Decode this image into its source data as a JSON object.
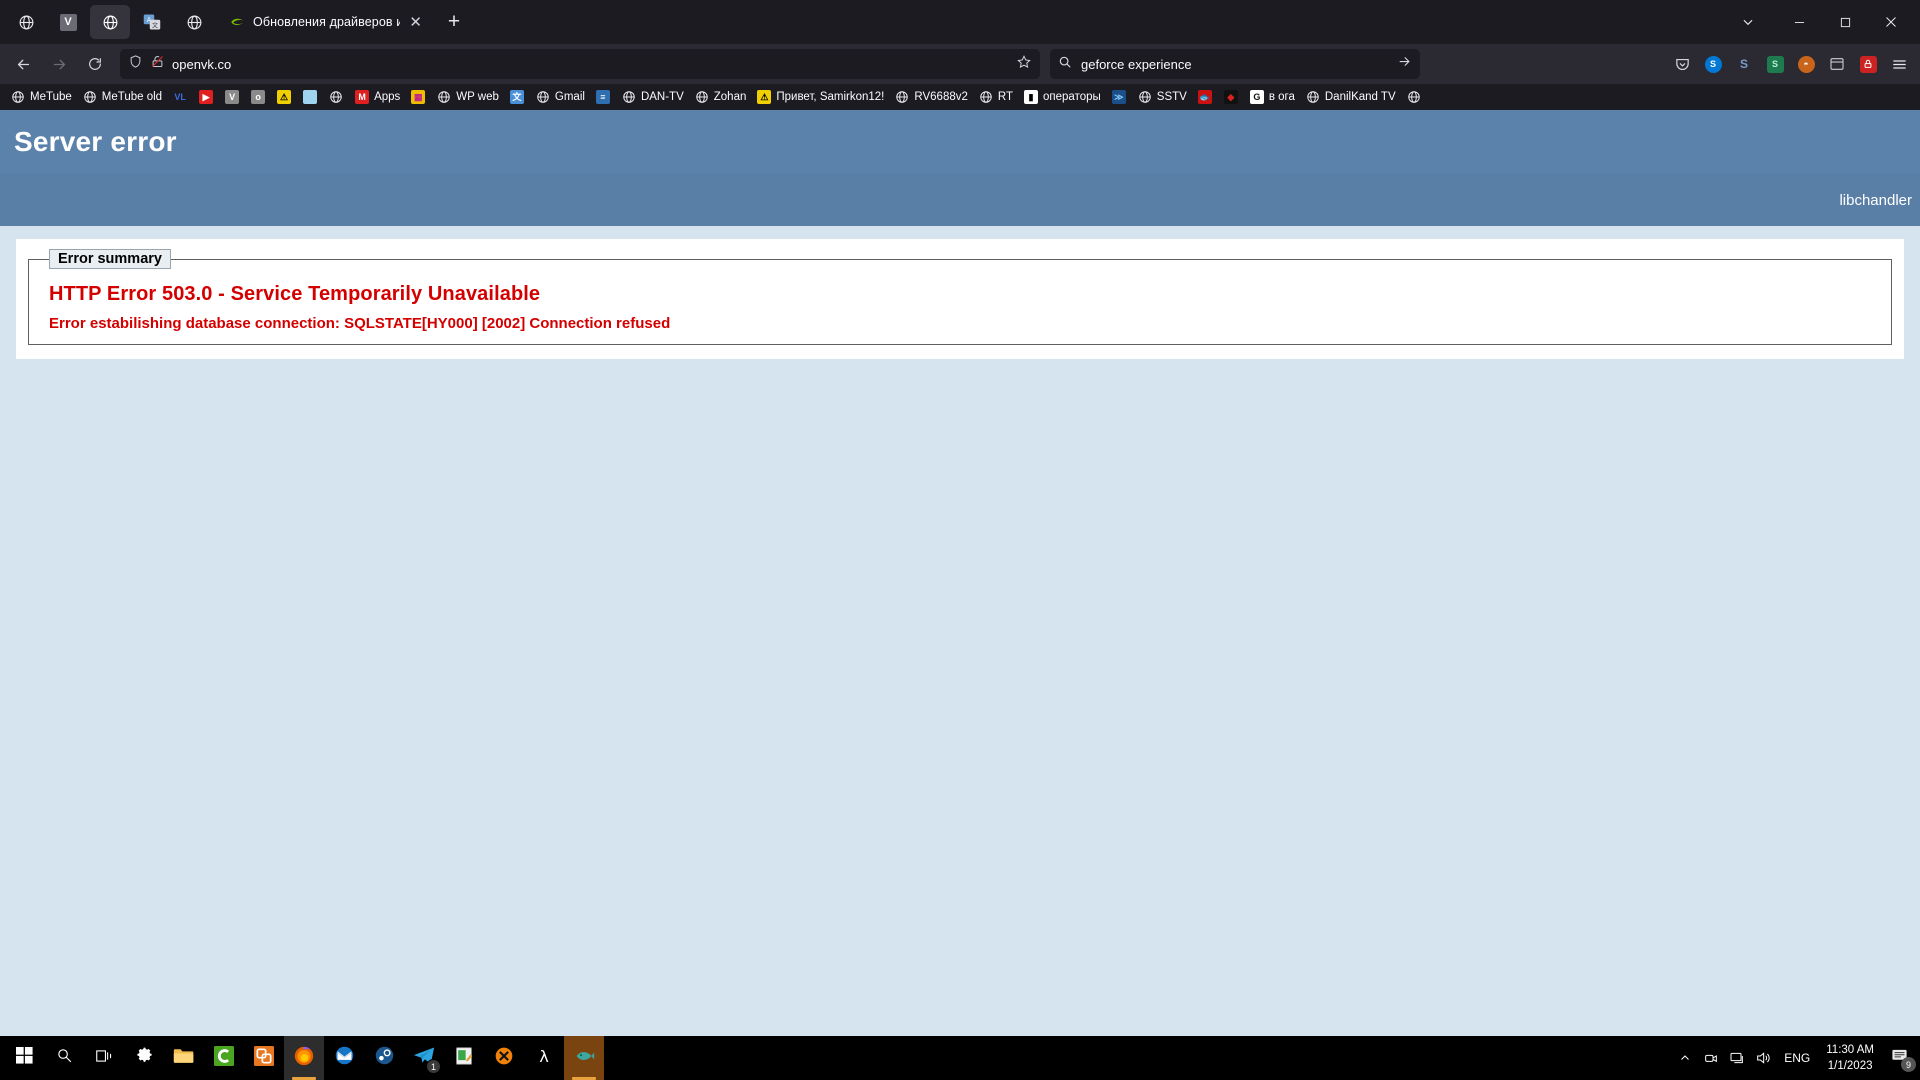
{
  "browser": {
    "pinned_tabs": [
      {
        "name": "globe-icon",
        "type": "globe"
      },
      {
        "name": "vk-icon",
        "type": "letter",
        "letter": "V",
        "bg": "#6b6b76"
      },
      {
        "name": "globe-icon-active",
        "type": "globe",
        "active": true
      },
      {
        "name": "translate-icon",
        "type": "translate"
      },
      {
        "name": "globe-icon-2",
        "type": "globe"
      }
    ],
    "tab": {
      "title": "Обновления драйверов и опти",
      "favicon": "nvidia-icon",
      "close_label": "✕"
    },
    "new_tab_label": "+",
    "window_controls": {
      "list_all_tabs": "⌄",
      "minimize": "—",
      "maximize": "▢",
      "close": "✕"
    },
    "nav": {
      "back": "←",
      "forward": "→",
      "reload": "⟳"
    },
    "urlbar": {
      "shield_icon": "shield-icon",
      "lock_icon": "broken-lock-icon",
      "url": "openvk.co",
      "bookmark_star": "☆"
    },
    "search": {
      "icon": "search-icon",
      "value": "geforce experience",
      "go": "→"
    },
    "extensions": [
      {
        "name": "pocket-icon",
        "glyph": "⌵",
        "bg": "transparent",
        "color": "#d6d6de"
      },
      {
        "name": "skype-extension-icon",
        "glyph": "S",
        "bg": "#0078d4",
        "color": "#ffffff"
      },
      {
        "name": "s-extension-icon",
        "glyph": "S",
        "bg": "transparent",
        "color": "#7a9cc6"
      },
      {
        "name": "s-green-extension-icon",
        "glyph": "S",
        "bg": "#1e7a4f",
        "color": "#9fe8c0"
      },
      {
        "name": "ublock-origin-icon",
        "glyph": "◓",
        "bg": "#c8651b",
        "color": "#ffffff"
      },
      {
        "name": "screenshot-extension-icon",
        "glyph": "▣",
        "bg": "transparent",
        "color": "#cfcfd8"
      },
      {
        "name": "red-lock-extension-icon",
        "glyph": "🔒",
        "bg": "#cc2222",
        "color": "#ffffff"
      },
      {
        "name": "app-menu-icon",
        "glyph": "☰",
        "bg": "transparent",
        "color": "#e8e8ee"
      }
    ],
    "bookmarks": [
      {
        "label": "MeTube",
        "icon": "globe"
      },
      {
        "label": "MeTube old",
        "icon": "globe"
      },
      {
        "label": "",
        "icon": "vlc",
        "chip_text": "VL",
        "chip_bg": "transparent",
        "chip_color": "#3b6fe0"
      },
      {
        "label": "",
        "icon": "youtube",
        "chip_text": "▶",
        "chip_bg": "#e02020",
        "chip_color": "#ffffff"
      },
      {
        "label": "",
        "icon": "vk-grey",
        "chip_text": "V",
        "chip_bg": "#8a8a8a",
        "chip_color": "#ffffff"
      },
      {
        "label": "",
        "icon": "o-grey",
        "chip_text": "o",
        "chip_bg": "#8a8a8a",
        "chip_color": "#ffffff"
      },
      {
        "label": "",
        "icon": "warning-yellow",
        "chip_text": "⚠",
        "chip_bg": "#f0d000",
        "chip_color": "#000000"
      },
      {
        "label": "",
        "icon": "sky-photo",
        "chip_text": "",
        "chip_bg": "#9fd4f0",
        "chip_color": "#ffffff"
      },
      {
        "label": "",
        "icon": "globe",
        "chip_text": "",
        "chip_bg": "transparent",
        "chip_color": "#ffffff"
      },
      {
        "label": "Apps",
        "icon": "gmail-m",
        "chip_text": "M",
        "chip_bg": "#e02020",
        "chip_color": "#ffffff"
      },
      {
        "label": "",
        "icon": "colorful",
        "chip_text": "▦",
        "chip_bg": "#f0c000",
        "chip_color": "#c02090"
      },
      {
        "label": "WP web",
        "icon": "globe"
      },
      {
        "label": "",
        "icon": "translate",
        "chip_text": "文",
        "chip_bg": "#4a90d9",
        "chip_color": "#ffffff"
      },
      {
        "label": "Gmail",
        "icon": "globe"
      },
      {
        "label": "",
        "icon": "stripes-blue",
        "chip_text": "≡",
        "chip_bg": "#2f6fb0",
        "chip_color": "#ffffff"
      },
      {
        "label": "DAN-TV",
        "icon": "globe"
      },
      {
        "label": "Zohan",
        "icon": "globe"
      },
      {
        "label": "Привет, Samirkon12!",
        "icon": "warning-yellow",
        "chip_text": "⚠",
        "chip_bg": "#f0d000",
        "chip_color": "#000000"
      },
      {
        "label": "RV6688v2",
        "icon": "globe"
      },
      {
        "label": "RT",
        "icon": "globe"
      },
      {
        "label": "операторы",
        "icon": "phone",
        "chip_text": "▮",
        "chip_bg": "#ffffff",
        "chip_color": "#000000"
      },
      {
        "label": "",
        "icon": "blue-swoosh",
        "chip_text": "≫",
        "chip_bg": "#1a4f8a",
        "chip_color": "#7fc4f0"
      },
      {
        "label": "SSTV",
        "icon": "globe"
      },
      {
        "label": "",
        "icon": "red-fish",
        "chip_text": "🐟",
        "chip_bg": "#cc1111",
        "chip_color": "#ffffff"
      },
      {
        "label": "",
        "icon": "red-diamond",
        "chip_text": "◆",
        "chip_bg": "#111111",
        "chip_color": "#dd2222"
      },
      {
        "label": "в ога",
        "icon": "g-letter",
        "chip_text": "G",
        "chip_bg": "#ffffff",
        "chip_color": "#111111"
      },
      {
        "label": "DanilKand TV",
        "icon": "globe"
      },
      {
        "label": "",
        "icon": "globe"
      }
    ]
  },
  "page": {
    "title": "Server error",
    "user": "libchandler",
    "error": {
      "legend": "Error summary",
      "line1": "HTTP Error 503.0 - Service Temporarily Unavailable",
      "line2": "Error estabilishing database connection: SQLSTATE[HY000] [2002] Connection refused"
    }
  },
  "taskbar": {
    "items": [
      {
        "name": "start-button",
        "icon": "windows-logo"
      },
      {
        "name": "search-button",
        "icon": "magnifier"
      },
      {
        "name": "task-view-button",
        "icon": "task-view"
      },
      {
        "name": "settings-button",
        "icon": "gear"
      },
      {
        "name": "file-explorer-button",
        "icon": "folder"
      },
      {
        "name": "c-app-button",
        "icon": "green-c"
      },
      {
        "name": "vmware-button",
        "icon": "orange-squares"
      },
      {
        "name": "firefox-button",
        "icon": "firefox",
        "active": true,
        "running": true
      },
      {
        "name": "thunderbird-button",
        "icon": "thunderbird"
      },
      {
        "name": "steam-button",
        "icon": "steam"
      },
      {
        "name": "telegram-button",
        "icon": "telegram",
        "badge": "1"
      },
      {
        "name": "notepad-button",
        "icon": "notepad"
      },
      {
        "name": "x-app-button",
        "icon": "orange-x"
      },
      {
        "name": "lambda-button",
        "icon": "lambda"
      },
      {
        "name": "fish-app-button",
        "icon": "fish",
        "active": true,
        "running": true
      }
    ],
    "tray": {
      "chevron": "⌃",
      "icons": [
        "camera-icon",
        "monitor-icon",
        "volume-icon"
      ],
      "language": "ENG",
      "time": "11:30 AM",
      "date": "1/1/2023",
      "notification_count": "9"
    }
  }
}
